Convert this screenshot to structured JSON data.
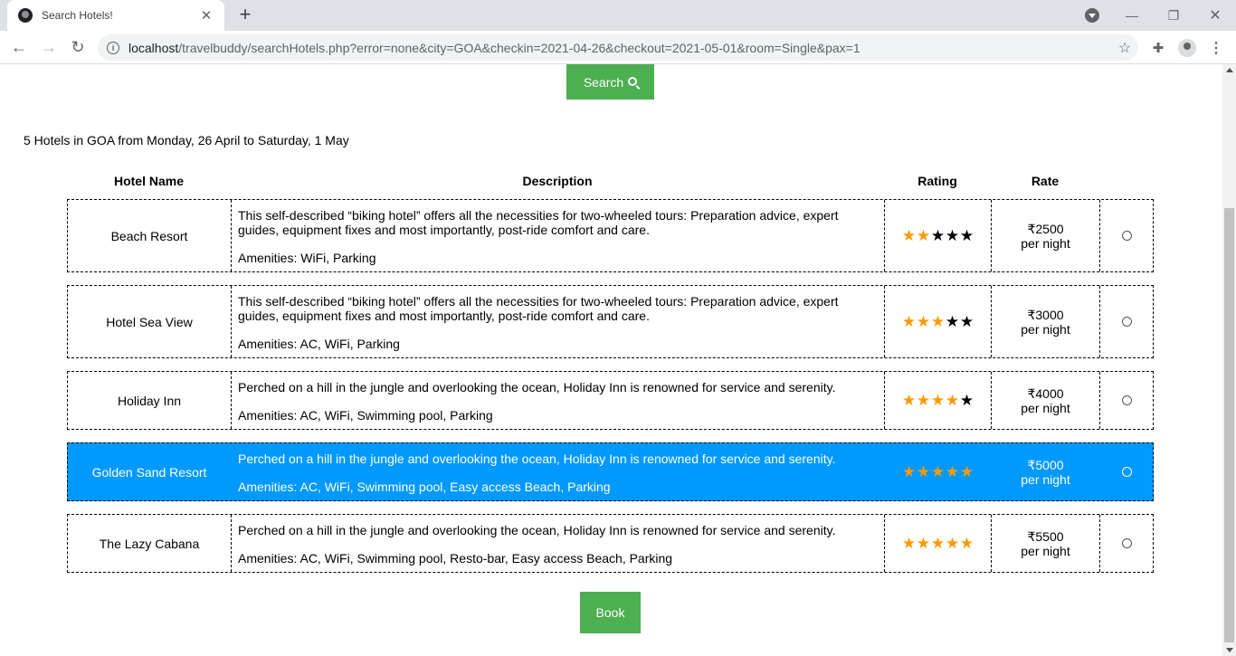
{
  "browser": {
    "tab_title": "Search Hotels!",
    "url_host": "localhost",
    "url_path": "/travelbuddy/searchHotels.php?error=none&city=GOA&checkin=2021-04-26&checkout=2021-05-01&room=Single&pax=1"
  },
  "page": {
    "search_label": "Search",
    "summary": "5 Hotels in GOA from Monday, 26 April to Saturday, 1 May",
    "columns": {
      "name": "Hotel Name",
      "description": "Description",
      "rating": "Rating",
      "rate": "Rate"
    },
    "hotels": [
      {
        "name": "Beach Resort",
        "description": "This self-described “biking hotel” offers all the necessities for two-wheeled tours: Preparation advice, expert guides, equipment fixes and most importantly, post-ride comfort and care.",
        "amenities": "Amenities: WiFi, Parking",
        "rating": 2,
        "price": "₹2500",
        "per": "per night"
      },
      {
        "name": "Hotel Sea View",
        "description": "This self-described “biking hotel” offers all the necessities for two-wheeled tours: Preparation advice, expert guides, equipment fixes and most importantly, post-ride comfort and care.",
        "amenities": "Amenities: AC, WiFi, Parking",
        "rating": 3,
        "price": "₹3000",
        "per": "per night"
      },
      {
        "name": "Holiday Inn",
        "description": "Perched on a hill in the jungle and overlooking the ocean, Holiday Inn is renowned for service and serenity.",
        "amenities": "Amenities: AC, WiFi, Swimming pool, Parking",
        "rating": 4,
        "price": "₹4000",
        "per": "per night"
      },
      {
        "name": "Golden Sand Resort",
        "description": "Perched on a hill in the jungle and overlooking the ocean, Holiday Inn is renowned for service and serenity.",
        "amenities": "Amenities: AC, WiFi, Swimming pool, Easy access Beach, Parking",
        "rating": 5,
        "price": "₹5000",
        "per": "per night"
      },
      {
        "name": "The Lazy Cabana",
        "description": "Perched on a hill in the jungle and overlooking the ocean, Holiday Inn is renowned for service and serenity.",
        "amenities": "Amenities: AC, WiFi, Swimming pool, Resto-bar, Easy access Beach, Parking",
        "rating": 5,
        "price": "₹5500",
        "per": "per night"
      }
    ],
    "selected_index": 3,
    "book_label": "Book"
  },
  "colors": {
    "button": "#4caf50",
    "selected_row": "#0099ff",
    "star_on": "#ff9900",
    "star_off": "#000000"
  }
}
